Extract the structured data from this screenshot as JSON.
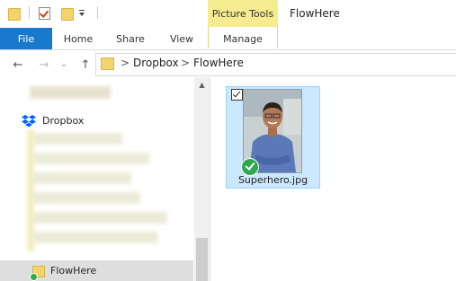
{
  "window": {
    "title": "FlowHere"
  },
  "contextual_tab_group": {
    "label": "Picture Tools",
    "color": "#f5ec8f"
  },
  "ribbon": {
    "file_tab": "File",
    "tabs": [
      "Home",
      "Share",
      "View",
      "Manage"
    ],
    "file_tab_color": "#1979ca"
  },
  "address_bar": {
    "breadcrumbs": [
      "Dropbox",
      "FlowHere"
    ],
    "separator": ">"
  },
  "nav_icons": {
    "back": "back-arrow-icon",
    "forward": "forward-arrow-icon",
    "up": "up-arrow-icon"
  },
  "navigation_pane": {
    "dropbox_label": "Dropbox",
    "selected_item": "FlowHere"
  },
  "files": [
    {
      "name": "Superhero.jpg",
      "selected": true,
      "checked": true,
      "sync_status": "synced"
    }
  ],
  "colors": {
    "selection_bg": "#cce8ff",
    "selection_border": "#99d1ff",
    "sync_green": "#2fa84f"
  }
}
